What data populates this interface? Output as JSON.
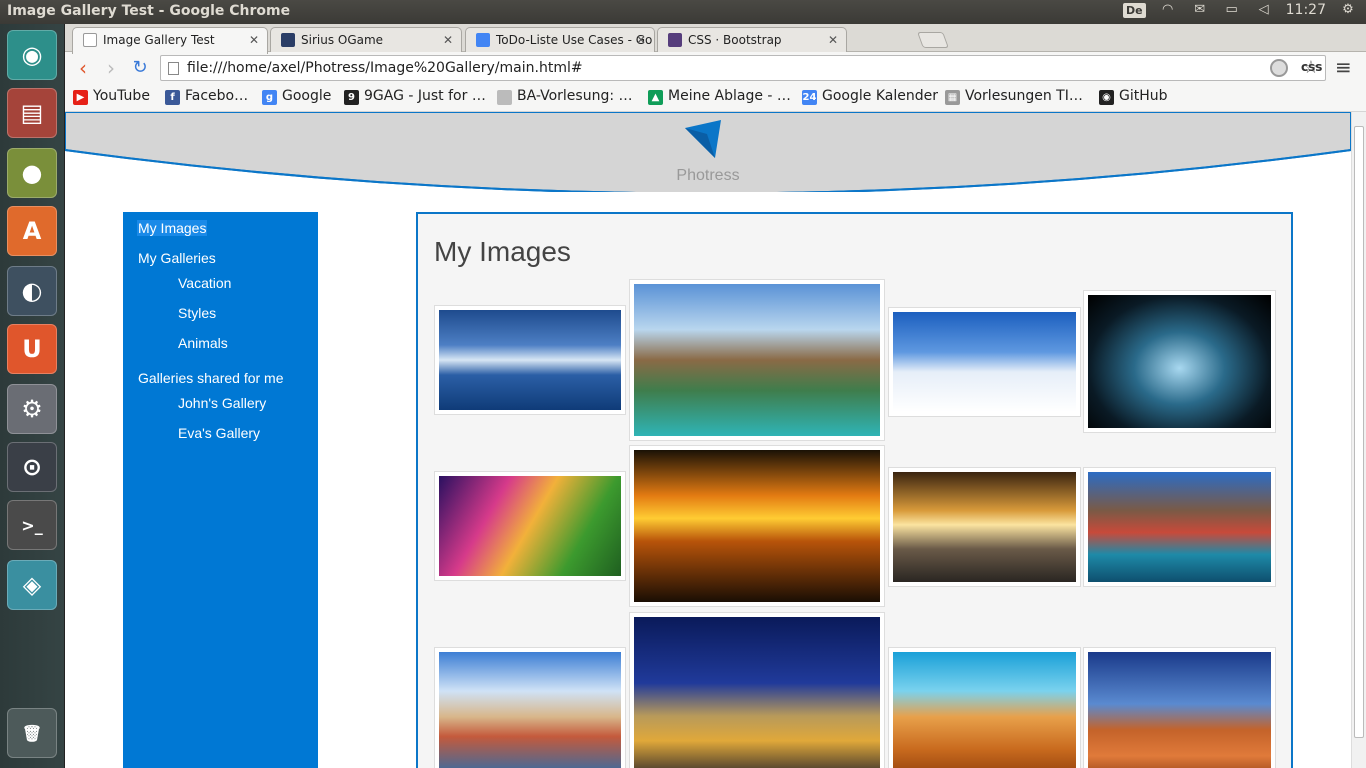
{
  "system": {
    "window_title": "Image Gallery Test - Google Chrome",
    "keyboard_layout": "De",
    "clock": "11:27"
  },
  "launcher": {
    "items": [
      {
        "name": "ubuntu-dash-icon",
        "glyph": "◉",
        "color": "#2d8f8a"
      },
      {
        "name": "files-icon",
        "glyph": "▤",
        "color": "#a5443a"
      },
      {
        "name": "chrome-icon",
        "glyph": "●",
        "color": "#7a8f3a"
      },
      {
        "name": "software-center-icon",
        "glyph": "A",
        "color": "#e06a2c"
      },
      {
        "name": "pidgin-icon",
        "glyph": "◐",
        "color": "#3e5060"
      },
      {
        "name": "ubuntu-one-icon",
        "glyph": "U",
        "color": "#e0562c"
      },
      {
        "name": "system-settings-icon",
        "glyph": "⚙",
        "color": "#6a6d74"
      },
      {
        "name": "steam-icon",
        "glyph": "⊙",
        "color": "#3a3f47"
      },
      {
        "name": "terminal-icon",
        "glyph": ">_",
        "color": "#4a4a4a"
      },
      {
        "name": "workspace-switcher-icon",
        "glyph": "◈",
        "color": "#3a8fa0"
      },
      {
        "name": "trash-icon",
        "glyph": "🗑",
        "color": "#4d5a5a"
      }
    ]
  },
  "browser": {
    "tabs": [
      {
        "label": "Image Gallery Test",
        "icon": "page-icon",
        "color": "#ffffff",
        "active": true
      },
      {
        "label": "Sirius OGame",
        "icon": "ogame-icon",
        "color": "#2a3d66",
        "active": false
      },
      {
        "label": "ToDo-Liste Use Cases - Go",
        "icon": "docs-icon",
        "color": "#4285f4",
        "active": false
      },
      {
        "label": "CSS · Bootstrap",
        "icon": "bootstrap-icon",
        "color": "#563d7c",
        "active": false
      }
    ],
    "url": "file:///home/axel/Photress/Image%20Gallery/main.html#",
    "extension_label": "css",
    "bookmarks": [
      {
        "label": "YouTube",
        "icon": "youtube-icon",
        "color": "#e62117",
        "glyph": "▶"
      },
      {
        "label": "Facebo…",
        "icon": "facebook-icon",
        "color": "#3b5998",
        "glyph": "f"
      },
      {
        "label": "Google",
        "icon": "google-icon",
        "color": "#4285f4",
        "glyph": "g"
      },
      {
        "label": "9GAG - Just for …",
        "icon": "9gag-icon",
        "color": "#222222",
        "glyph": "9"
      },
      {
        "label": "BA-Vorlesung: …",
        "icon": "page-icon",
        "color": "#bbbbbb",
        "glyph": ""
      },
      {
        "label": "Meine Ablage - …",
        "icon": "drive-icon",
        "color": "#0f9d58",
        "glyph": "▲"
      },
      {
        "label": "Google Kalender",
        "icon": "calendar-icon",
        "color": "#4285f4",
        "glyph": "24"
      },
      {
        "label": "Vorlesungen TI…",
        "icon": "lecture-icon",
        "color": "#999999",
        "glyph": "▦"
      },
      {
        "label": "GitHub",
        "icon": "github-icon",
        "color": "#222222",
        "glyph": "◉"
      }
    ]
  },
  "page": {
    "brand": "Photress",
    "accent_color": "#0078d4",
    "sidebar": {
      "my_images": "My Images",
      "my_galleries": "My Galleries",
      "galleries": [
        "Vacation",
        "Styles",
        "Animals"
      ],
      "shared_heading": "Galleries shared for me",
      "shared": [
        "John's Gallery",
        "Eva's Gallery"
      ]
    },
    "main_title": "My Images",
    "images": [
      {
        "name": "pier-ocean",
        "gradient": "linear-gradient(#1e4b8e 0%,#4d7fc4 35%,#d7e6f4 50%,#2b5fa6 65%,#0f3b78 100%)"
      },
      {
        "name": "tropical-waterfall",
        "gradient": "linear-gradient(#5a92d6 0%,#b9d6ee 30%,#8a6a46 50%,#3f7d4c 70%,#2fb4b6 100%)"
      },
      {
        "name": "snowy-trees",
        "gradient": "linear-gradient(#1c5fbf 0%,#5e98e0 40%,#e6eef8 60%,#ffffff 100%)"
      },
      {
        "name": "jumping-silhouettes",
        "gradient": "radial-gradient(ellipse at 50% 55%,#a8d8f0 0%,#2a6a8a 35%,#0a1a25 70%,#000 100%)"
      },
      {
        "name": "colorful-meadow",
        "gradient": "linear-gradient(120deg,#2a1060 0%,#d63a8a 30%,#f2b13a 50%,#3c9a2e 75%,#1f5f20 100%)"
      },
      {
        "name": "sunset-couple",
        "gradient": "linear-gradient(#1a1206 0%,#e37b12 30%,#ffcc33 45%,#b8540a 60%,#1a0e04 100%)"
      },
      {
        "name": "city-road",
        "gradient": "linear-gradient(#3a2410 0%,#d89a3a 35%,#fbe4a0 48%,#6a5a48 70%,#2a2622 100%)"
      },
      {
        "name": "colorful-coast-town",
        "gradient": "linear-gradient(#2c6cc4 0%,#7a5a46 35%,#c84a3a 55%,#1e8aa8 75%,#0e4f6e 100%)"
      },
      {
        "name": "harbor-village",
        "gradient": "linear-gradient(#3c7ed4 0%,#cfe2f6 30%,#d8b68a 50%,#c45a3c 65%,#1a6fb8 100%)"
      },
      {
        "name": "night-city",
        "gradient": "linear-gradient(#0a1a5a 0%,#203a9a 40%,#b89a5a 60%,#e0a83a 75%,#1a1a2a 100%)"
      },
      {
        "name": "desert-dunes",
        "gradient": "linear-gradient(#1aa0d8 0%,#7ad2ee 30%,#e8a04a 50%,#c86a1e 75%,#8a3a0a 100%)"
      },
      {
        "name": "monument-valley",
        "gradient": "linear-gradient(#1a3a8a 0%,#5a8ad0 40%,#c4632a 60%,#e07a3a 80%,#8a3a14 100%)"
      }
    ]
  }
}
